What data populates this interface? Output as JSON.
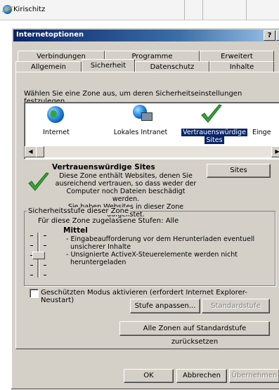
{
  "browser": {
    "tab_title": "Kirischitz"
  },
  "dialog": {
    "title": "Internetoptionen",
    "help_label": "?",
    "close_label": "×",
    "tabs_back": [
      "Verbindungen",
      "Programme",
      "Erweitert"
    ],
    "tabs_front": [
      "Allgemein",
      "Sicherheit",
      "Datenschutz",
      "Inhalte"
    ],
    "active_tab": "Sicherheit"
  },
  "security": {
    "zone_prompt": "Wählen Sie eine Zone aus, um deren Sicherheitseinstellungen festzulegen.",
    "zones": [
      {
        "label": "Internet",
        "icon": "globe-icon"
      },
      {
        "label": "Lokales Intranet",
        "icon": "intranet-icon"
      },
      {
        "label_line1": "Vertrauenswürdige",
        "label_line2": "Sites",
        "icon": "check-icon",
        "selected": true
      },
      {
        "label": "Einge",
        "icon": "none"
      }
    ],
    "selected_zone": {
      "title": "Vertrauenswürdige Sites",
      "desc_lines": [
        "Diese Zone enthält Websites, denen Sie",
        "ausreichend vertrauen, so dass weder der",
        "Computer noch Dateien beschädigt werden.",
        "Sie haben Websites in dieser Zone aufgelistet."
      ],
      "sites_button": "Sites"
    },
    "level_group": {
      "title": "Sicherheitsstufe dieser Zone",
      "allowed": "Für diese Zone zugelassene Stufen: Alle",
      "level_name": "Mittel",
      "level_lines": [
        "- Eingabeaufforderung vor dem Herunterladen eventuell",
        "  unsicherer Inhalte",
        "- Unsignierte ActiveX-Steuerelemente werden nicht",
        "  heruntergeladen"
      ]
    },
    "protected_mode_label": "Geschützten Modus aktivieren (erfordert Internet Explorer-Neustart)",
    "protected_mode_checked": false,
    "custom_level_button": "Stufe anpassen...",
    "default_level_button": "Standardstufe",
    "reset_all_button": "Alle Zonen auf Standardstufe zurücksetzen"
  },
  "footer": {
    "ok": "OK",
    "cancel": "Abbrechen",
    "apply": "Übernehmen"
  },
  "colors": {
    "title_start": "#0a246a",
    "title_end": "#a6caf0",
    "face": "#d4d0c8",
    "selection": "#0a246a",
    "check": "#3aa23a"
  }
}
